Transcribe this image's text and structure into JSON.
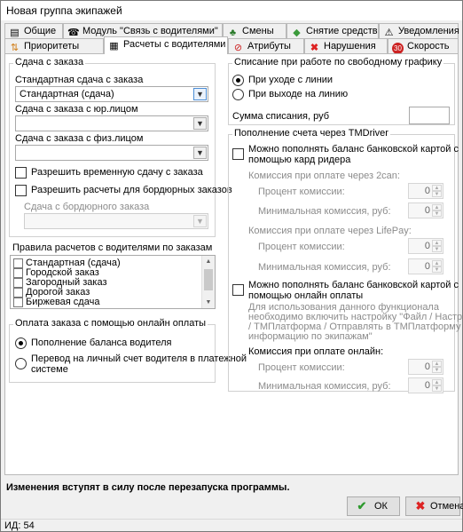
{
  "window": {
    "title": "Новая группа экипажей"
  },
  "tabs_row1": [
    {
      "label": "Общие",
      "icon": "document-icon"
    },
    {
      "label": "Модуль \"Связь с водителями\"",
      "icon": "phone-icon"
    },
    {
      "label": "Смены",
      "icon": "people-icon"
    },
    {
      "label": "Снятие средств",
      "icon": "money-icon"
    },
    {
      "label": "Уведомления",
      "icon": "warning-icon"
    }
  ],
  "tabs_row2": [
    {
      "label": "Приоритеты",
      "icon": "sort-icon"
    },
    {
      "label": "Расчеты с водителями",
      "icon": "calculator-icon"
    },
    {
      "label": "Атрибуты",
      "icon": "no-smoking-icon"
    },
    {
      "label": "Нарушения",
      "icon": "cross-icon"
    },
    {
      "label": "Скорость",
      "icon": "speed-icon"
    }
  ],
  "left": {
    "group_title": "Сдача с заказа",
    "standard_label": "Стандартная сдача с заказа",
    "standard_value": "Стандартная (сдача)",
    "legal_label": "Сдача с заказа с юр.лицом",
    "legal_value": "",
    "physical_label": "Сдача с заказа с физ.лицом",
    "physical_value": "",
    "temp_change_label": "Разрешить временную сдачу с заказа",
    "border_orders_label": "Разрешить расчеты для бордюрных заказов",
    "border_change_label": "Сдача с бордюрного заказа",
    "rules_label": "Правила расчетов с водителями по заказам",
    "rules": [
      "Стандартная (сдача)",
      "Городской заказ",
      "Загородный заказ",
      "Дорогой заказ",
      "Биржевая сдача"
    ],
    "online_group_title": "Оплата заказа с помощью онлайн оплаты",
    "online_option1": "Пополнение баланса водителя",
    "online_option2a": "Перевод на личный счет водителя в платежной",
    "online_option2b": "системе"
  },
  "right": {
    "writeoff_title": "Списание при работе по свободному графику",
    "writeoff_option1": "При уходе с линии",
    "writeoff_option2": "При выходе на линию",
    "writeoff_amount_label": "Сумма списания, руб",
    "writeoff_amount_value": "",
    "tmdriver_title": "Пополнение счета через TMDriver",
    "card_reader_a": "Можно пополнять баланс банковской картой с",
    "card_reader_b": "помощью кард ридера",
    "twocan_label": "Комиссия при оплате через 2can:",
    "percent_label": "Процент комиссии:",
    "min_label": "Минимальная комиссия, руб:",
    "lifepay_label": "Комиссия при оплате через LifePay:",
    "online_card_a": "Можно пополнять баланс банковской картой с",
    "online_card_b": "помощью онлайн оплаты",
    "info_line1": "Для использования данного функционала",
    "info_line2": "необходимо включить настройку \"Файл / Настройки",
    "info_line3": "/ ТМПлатформа / Отправлять в ТМПлатформу",
    "info_line4": "информацию по экипажам\"",
    "online_commission_label": "Комиссия при оплате онлайн:",
    "spin_value": "0"
  },
  "footer": {
    "notice": "Изменения вступят в силу после перезапуска программы.",
    "ok": "ОК",
    "cancel": "Отмена",
    "status": "ИД: 54"
  }
}
